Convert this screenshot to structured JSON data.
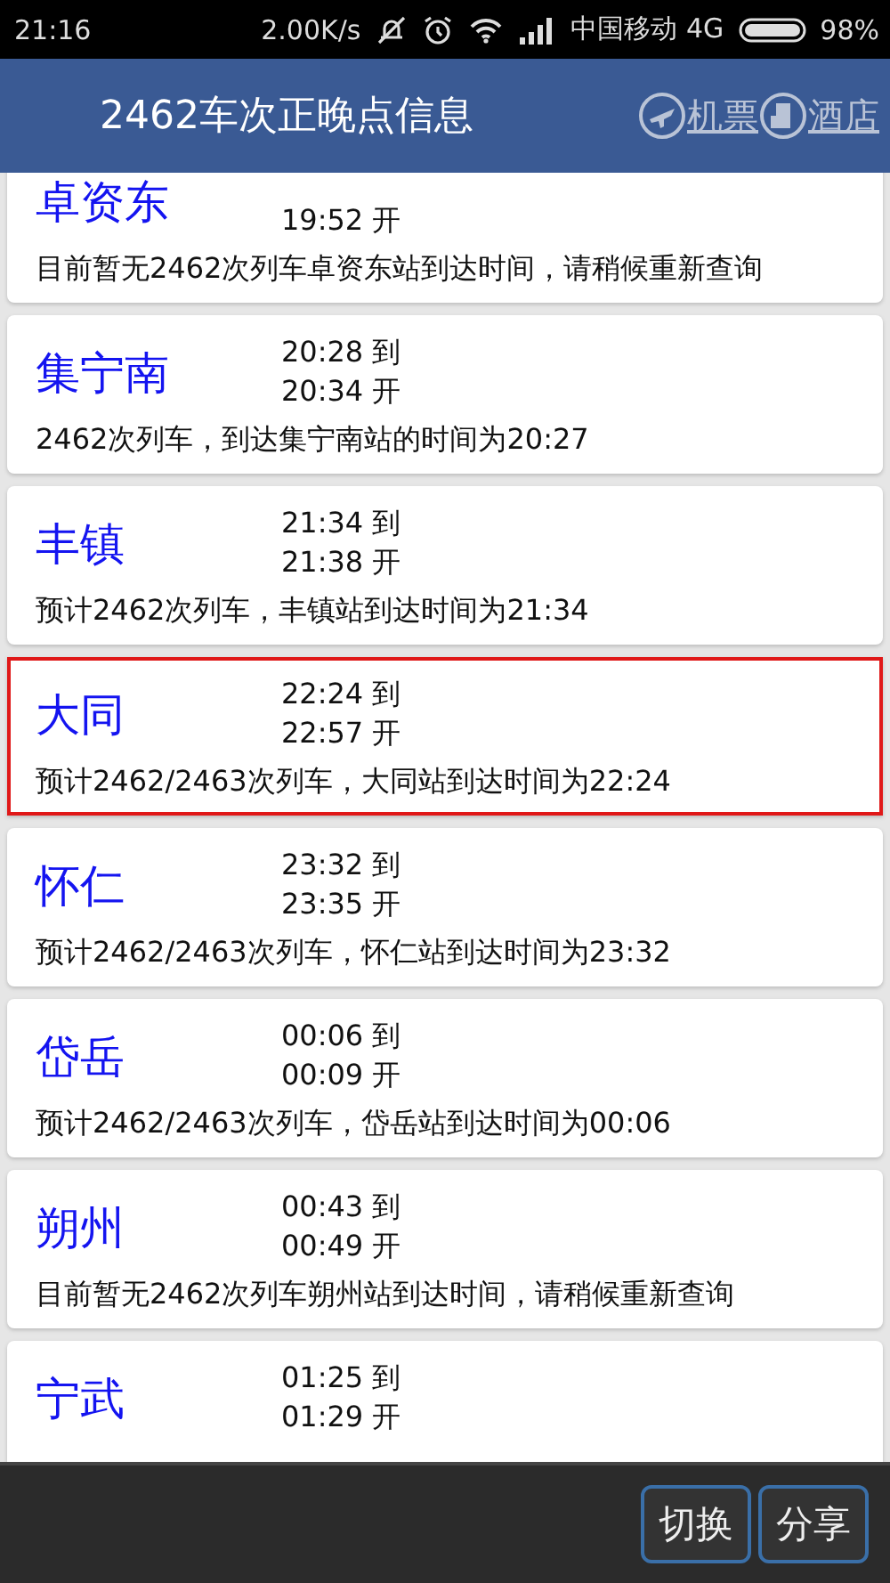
{
  "status_bar": {
    "time": "21:16",
    "speed": "2.00K/s",
    "carrier": "中国移动 4G",
    "battery": "98%"
  },
  "header": {
    "title": "2462车次正晚点信息",
    "links": [
      "机票",
      "酒店"
    ]
  },
  "stops": [
    {
      "station": "卓资东",
      "depart": "19:52 开",
      "message": "目前暂无2462次列车卓资东站到达时间，请稍候重新查询",
      "selected": false
    },
    {
      "station": "集宁南",
      "arrive": "20:28 到",
      "depart": "20:34 开",
      "message": "2462次列车，到达集宁南站的时间为20:27",
      "selected": false
    },
    {
      "station": "丰镇",
      "arrive": "21:34 到",
      "depart": "21:38 开",
      "message": "预计2462次列车，丰镇站到达时间为21:34",
      "selected": false
    },
    {
      "station": "大同",
      "arrive": "22:24 到",
      "depart": "22:57 开",
      "message": "预计2462/2463次列车，大同站到达时间为22:24",
      "selected": true
    },
    {
      "station": "怀仁",
      "arrive": "23:32 到",
      "depart": "23:35 开",
      "message": "预计2462/2463次列车，怀仁站到达时间为23:32",
      "selected": false
    },
    {
      "station": "岱岳",
      "arrive": "00:06 到",
      "depart": "00:09 开",
      "message": "预计2462/2463次列车，岱岳站到达时间为00:06",
      "selected": false
    },
    {
      "station": "朔州",
      "arrive": "00:43 到",
      "depart": "00:49 开",
      "message": "目前暂无2462次列车朔州站到达时间，请稍候重新查询",
      "selected": false
    },
    {
      "station": "宁武",
      "arrive": "01:25 到",
      "depart": "01:29 开",
      "selected": false
    }
  ],
  "bottom_bar": {
    "buttons": [
      "切换",
      "分享"
    ]
  }
}
